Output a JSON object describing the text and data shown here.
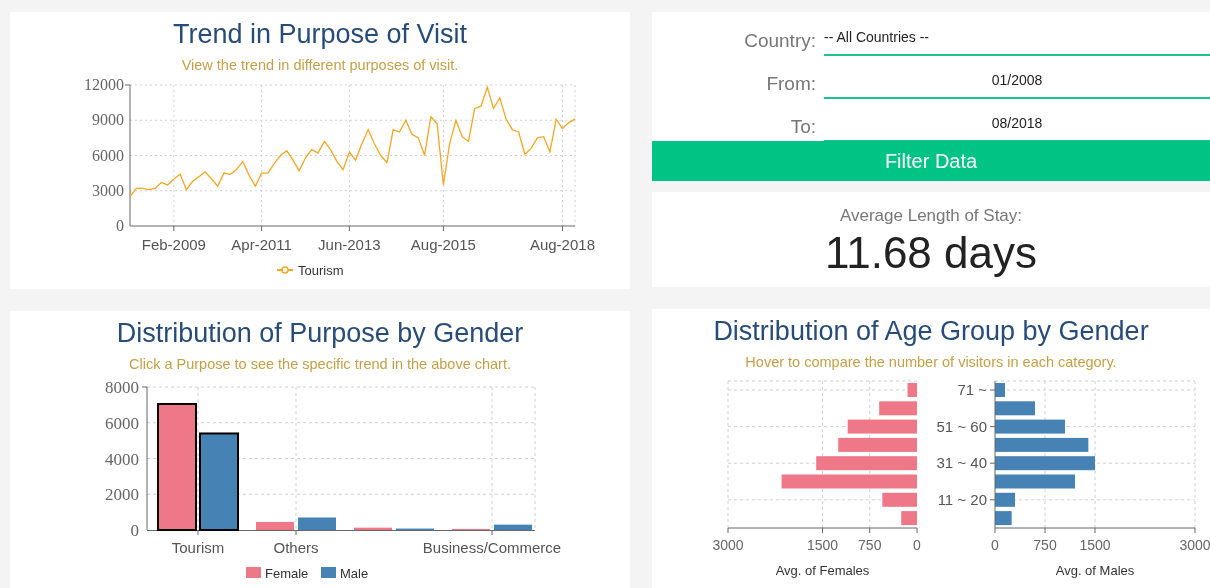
{
  "trend_card": {
    "title": "Trend in Purpose of Visit",
    "subtitle": "View the trend in different purposes of visit.",
    "chart_data": {
      "type": "line",
      "grid": true,
      "legend": "bottom",
      "categories": [
        null,
        null,
        null,
        null,
        null,
        null,
        null,
        "Feb-2009",
        null,
        null,
        null,
        null,
        null,
        null,
        null,
        null,
        null,
        null,
        null,
        null,
        null,
        "Apr-2011",
        null,
        null,
        null,
        null,
        null,
        null,
        null,
        null,
        null,
        null,
        null,
        null,
        null,
        "Jun-2013",
        null,
        null,
        null,
        null,
        null,
        null,
        null,
        null,
        null,
        null,
        null,
        null,
        null,
        null,
        "Aug-2015",
        null,
        null,
        null,
        null,
        null,
        null,
        null,
        null,
        null,
        null,
        null,
        null,
        null,
        null,
        null,
        null,
        null,
        null,
        "Aug-2018",
        null,
        null
      ],
      "ylim": [
        0,
        12000
      ],
      "yticks": [
        0,
        3000,
        6000,
        9000,
        12000
      ],
      "series": [
        {
          "name": "Tourism",
          "color": "#f5a623",
          "values": [
            2500,
            3200,
            3200,
            3100,
            3200,
            3700,
            3500,
            4000,
            4400,
            3100,
            3800,
            4200,
            4600,
            4000,
            3400,
            4500,
            4400,
            4800,
            5500,
            4300,
            3400,
            4500,
            4500,
            5300,
            6000,
            6400,
            5600,
            4700,
            5800,
            6500,
            6200,
            7200,
            6500,
            5500,
            4800,
            6300,
            5600,
            7000,
            8200,
            7000,
            6000,
            5400,
            8200,
            8000,
            9000,
            7800,
            7500,
            6000,
            9300,
            8700,
            3500,
            7000,
            9000,
            7600,
            7200,
            10000,
            10200,
            11800,
            10000,
            10900,
            9100,
            8200,
            8000,
            6100,
            6600,
            7500,
            7600,
            6300,
            9100,
            8300,
            8800,
            9100
          ]
        }
      ]
    }
  },
  "filter_panel": {
    "fields": [
      {
        "kind": "select",
        "label": "Country:",
        "value": "-- All Countries --"
      },
      {
        "kind": "date",
        "label": "From:",
        "value": "01/2008"
      },
      {
        "kind": "date",
        "label": "To:",
        "value": "08/2018"
      }
    ],
    "button": "Filter Data"
  },
  "stay_card": {
    "label": "Average Length of Stay:",
    "value": "11.68 days"
  },
  "purpose_card": {
    "title": "Distribution of Purpose by Gender",
    "subtitle": "Click a Purpose to see the specific trend in the above chart.",
    "highlighted": [
      true,
      false,
      false,
      false
    ],
    "chart_data": {
      "type": "bar",
      "grid": true,
      "legend": "bottom",
      "categories": [
        "Tourism",
        "Others",
        null,
        "Business/Commerce"
      ],
      "ylim": [
        0,
        8000
      ],
      "yticks": [
        0,
        2000,
        4000,
        6000,
        8000
      ],
      "series": [
        {
          "name": "Female",
          "color": "#ee7788",
          "values": [
            7050,
            450,
            130,
            60
          ]
        },
        {
          "name": "Male",
          "color": "#4682b4",
          "values": [
            5400,
            700,
            80,
            300
          ]
        }
      ]
    }
  },
  "age_card": {
    "title": "Distribution of Age Group by Gender",
    "subtitle": "Hover to compare the number of visitors in each category.",
    "charts": [
      {
        "chart_data": {
          "type": "bar",
          "orientation": "horizontal",
          "grid": true,
          "xlabel": "Avg. of Females",
          "xlim": [
            3000,
            0
          ],
          "xticks": [
            3000,
            1500,
            750,
            0
          ],
          "series": [
            {
              "color": "#ee7788",
              "values": [
                150,
                600,
                1100,
                1250,
                1600,
                2150,
                550,
                250
              ]
            }
          ]
        }
      },
      {
        "chart_data": {
          "type": "bar",
          "orientation": "horizontal",
          "grid": true,
          "xlabel": "Avg. of Males",
          "xlim": [
            0,
            3000
          ],
          "xticks": [
            0,
            750,
            1500,
            3000
          ],
          "categories": [
            "71 ~",
            null,
            "51 ~ 60",
            null,
            "31 ~ 40",
            null,
            "11 ~ 20",
            null
          ],
          "series": [
            {
              "color": "#4682b4",
              "values": [
                150,
                600,
                1050,
                1400,
                1500,
                1200,
                300,
                250
              ]
            }
          ]
        }
      }
    ]
  }
}
